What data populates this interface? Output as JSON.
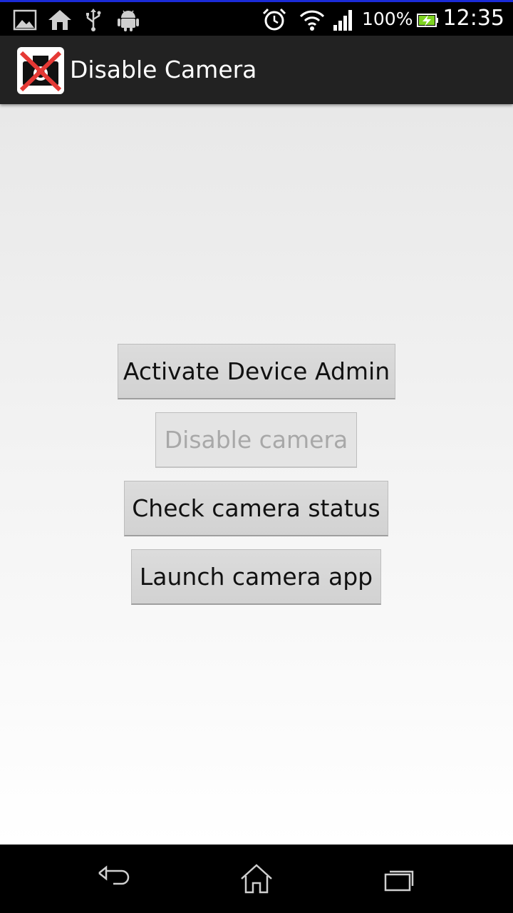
{
  "status_bar": {
    "battery_percent": "100%",
    "clock": "12:35",
    "left_icons": [
      "image-icon",
      "home-icon",
      "usb-icon",
      "android-icon"
    ],
    "right_icons": [
      "alarm-icon",
      "wifi-icon",
      "signal-icon",
      "battery-charging-icon"
    ]
  },
  "action_bar": {
    "title": "Disable Camera",
    "icon": "disabled-camera-icon"
  },
  "buttons": {
    "activate_admin": "Activate Device Admin",
    "disable_camera": "Disable camera",
    "check_status": "Check camera status",
    "launch_camera": "Launch camera app"
  },
  "nav_bar": {
    "icons": [
      "back-icon",
      "home-icon",
      "recent-apps-icon"
    ]
  }
}
